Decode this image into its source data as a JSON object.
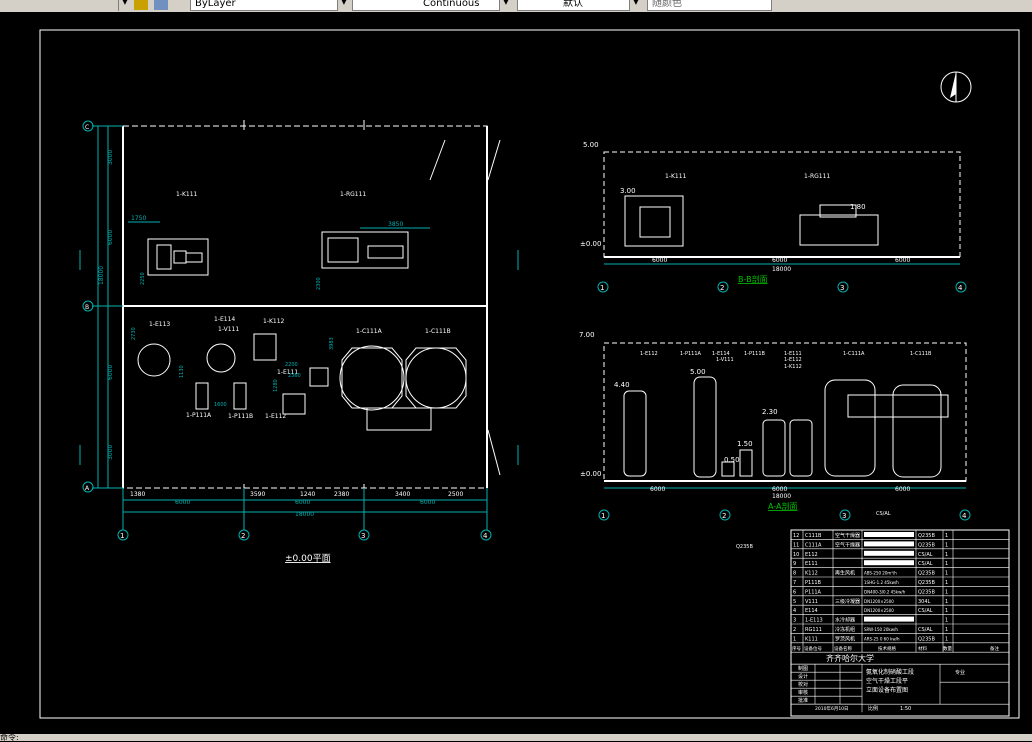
{
  "toolbar": {
    "layer_value": "ByLayer",
    "linetype_value": "Continuous",
    "lineweight_value": "默认",
    "plotstyle_value": "随颜色"
  },
  "plan": {
    "title": "±0.00平面",
    "labels": [
      "1-K111",
      "1-RG111",
      "1-E113",
      "1-E114",
      "1-V111",
      "1-K112",
      "1-C111A",
      "1-C111B",
      "1-E111",
      "1-P111A",
      "1-P111B",
      "1-E112"
    ],
    "row_labels": [
      "C",
      "B",
      "A"
    ],
    "col_labels": [
      "1",
      "2",
      "3",
      "4"
    ],
    "dims_top": [
      "1750",
      "3850"
    ],
    "dims_v": [
      "3000",
      "6000",
      "18000",
      "6000",
      "3000",
      "2730",
      "2250",
      "3983",
      "2300",
      "1130",
      "1280"
    ],
    "dims_bottom": [
      "1380",
      "3590",
      "1240",
      "2380",
      "3400",
      "2500"
    ],
    "dims_bottom2": [
      "6000",
      "6000",
      "6000"
    ],
    "dims_total": "18000",
    "dims_inner": [
      "2200",
      "1600",
      "2360"
    ]
  },
  "section_bb": {
    "title": "B-B剖面",
    "levels": [
      "5.00",
      "±0.00",
      "3.00",
      "1.80"
    ],
    "labels": [
      "1-K111",
      "1-RG111"
    ],
    "dims": [
      "6000",
      "6000",
      "6000"
    ],
    "dim_total": "18000",
    "axes": [
      "1",
      "2",
      "3",
      "4"
    ]
  },
  "section_aa": {
    "title": "A-A剖面",
    "levels": [
      "7.00",
      "4.40",
      "5.00",
      "2.30",
      "1.50",
      "0.50",
      "±0.00"
    ],
    "labels": [
      "1-E112",
      "1-P111A",
      "1-E114",
      "1-V111",
      "1-P111B",
      "1-E111",
      "1-E112",
      "1-K112",
      "1-C111A",
      "1-C111B"
    ],
    "dims": [
      "6000",
      "6000",
      "6000"
    ],
    "dim_total": "18000",
    "axes": [
      "1",
      "2",
      "3",
      "4"
    ],
    "material_note": "CS/AL"
  },
  "q235_note": "Q235B",
  "table": {
    "rows": [
      {
        "no": "12",
        "tag": "C111B",
        "name": "空气干燥器",
        "mat": "Q235B",
        "qty": "1"
      },
      {
        "no": "11",
        "tag": "C111A",
        "name": "空气干燥器",
        "mat": "Q235B",
        "qty": "1"
      },
      {
        "no": "10",
        "tag": "E112",
        "name": "",
        "mat": "CS/AL",
        "qty": "1"
      },
      {
        "no": "9",
        "tag": "E111",
        "name": "",
        "mat": "CS/AL",
        "qty": "1"
      },
      {
        "no": "8",
        "tag": "K112",
        "name": "再生风机",
        "spec": "ABS-250 20m³/h",
        "mat": "Q235B",
        "qty": "1"
      },
      {
        "no": "7",
        "tag": "P111B",
        "name": "",
        "spec": "1SHG-1.2 45kw/h",
        "mat": "Q235B",
        "qty": "1"
      },
      {
        "no": "6",
        "tag": "P111A",
        "name": "",
        "spec": "DN400-3/0.2 45kw/h",
        "mat": "Q235B",
        "qty": "1"
      },
      {
        "no": "5",
        "tag": "V111",
        "name": "三级冷凝器",
        "spec": "DN1200×2500",
        "mat": "304L",
        "qty": "1"
      },
      {
        "no": "4",
        "tag": "E114",
        "name": "",
        "spec": "DN1200×2500",
        "mat": "CS/AL",
        "qty": "1"
      },
      {
        "no": "3",
        "tag": "1-E113",
        "name": "水冷却器",
        "mat": "",
        "qty": "1"
      },
      {
        "no": "2",
        "tag": "RG111",
        "name": "冷冻机组",
        "spec": "SRW-150 20kw/h",
        "mat": "CS/AL",
        "qty": "1"
      },
      {
        "no": "1",
        "tag": "K111",
        "name": "罗茨风机",
        "spec": "ARS-25 0 60 kw/h",
        "mat": "Q235B",
        "qty": "1"
      }
    ],
    "header": [
      "序号",
      "设备位号",
      "设备名称",
      "技术规格",
      "材料",
      "数量",
      "备注"
    ],
    "school": "齐齐哈尔大学",
    "drawing_title_1": "氨氧化制硝酸工段",
    "drawing_title_2": "空气干燥工段平",
    "drawing_title_3": "立面设备布置图",
    "roles": [
      "制图",
      "设计",
      "校对",
      "审核",
      "批准"
    ],
    "date": "2010年6月10日",
    "scale_label": "比例",
    "scale": "1:50",
    "major_label": "专业"
  },
  "colors": {
    "line": "#ffffff",
    "dim": "#00b0b0",
    "green": "#00c000",
    "toolbar_bg": "#d4d0c8"
  },
  "status": {
    "text": "命令:"
  }
}
